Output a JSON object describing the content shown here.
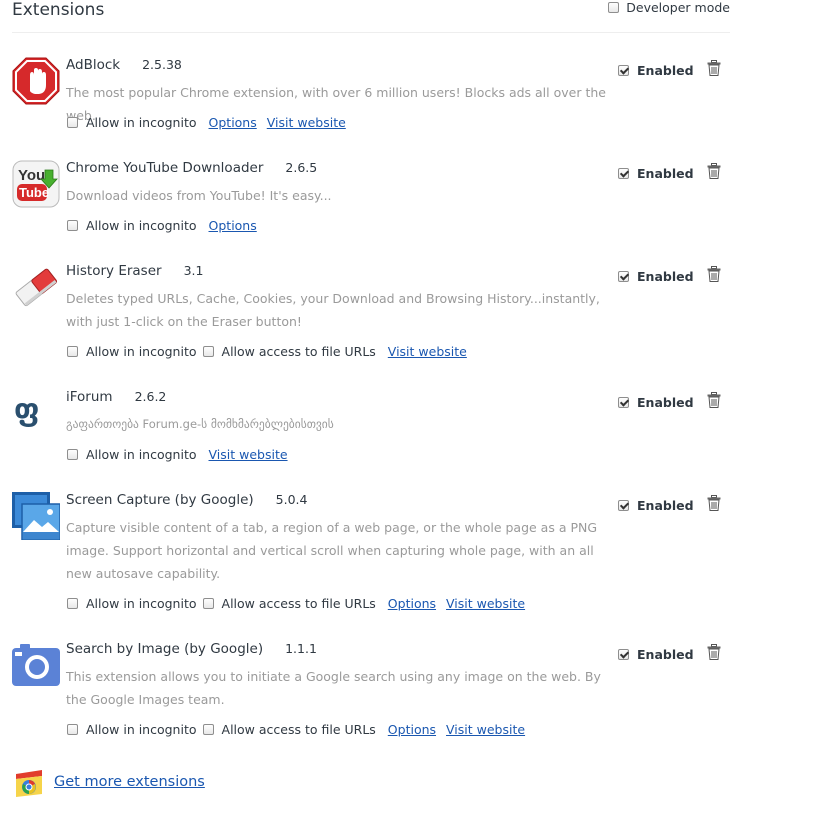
{
  "header": {
    "title": "Extensions",
    "developer_mode_label": "Developer mode",
    "developer_mode_checked": false
  },
  "common": {
    "enabled_label": "Enabled",
    "incognito_label": "Allow in incognito",
    "file_urls_label": "Allow access to file URLs",
    "options_label": "Options",
    "visit_label": "Visit website"
  },
  "extensions": [
    {
      "name": "AdBlock",
      "version": "2.5.38",
      "description": "The most popular Chrome extension, with over 6 million users! Blocks ads all over the web.",
      "enabled": true,
      "icon": "adblock-stop-hand-icon"
    },
    {
      "name": "Chrome YouTube Downloader",
      "version": "2.6.5",
      "description": "Download videos from YouTube! It's easy...",
      "enabled": true,
      "icon": "youtube-downloader-icon",
      "icon_text_top": "You",
      "icon_text_bottom": "Tube"
    },
    {
      "name": "History Eraser",
      "version": "3.1",
      "description": "Deletes typed URLs, Cache, Cookies, your Download and Browsing History...instantly, with just 1-click on the Eraser button!",
      "enabled": true,
      "icon": "eraser-icon"
    },
    {
      "name": "iForum",
      "version": "2.6.2",
      "description": "გაფართოება Forum.ge-ს მომხმარებლებისთვის",
      "enabled": true,
      "icon": "iforum-logo-icon",
      "icon_text": "ფ"
    },
    {
      "name": "Screen Capture (by Google)",
      "version": "5.0.4",
      "description": "Capture visible content of a tab, a region of a web page, or the whole page as a PNG image. Support horizontal and vertical scroll when capturing whole page, with an all new autosave capability.",
      "enabled": true,
      "icon": "screen-capture-icon"
    },
    {
      "name": "Search by Image (by Google)",
      "version": "1.1.1",
      "description": "This extension allows you to initiate a Google search using any image on the web. By the Google Images team.",
      "enabled": true,
      "icon": "camera-icon"
    }
  ],
  "footer": {
    "get_more_label": "Get more extensions",
    "icon": "chrome-web-store-icon"
  },
  "colors": {
    "link": "#1a57b0",
    "text": "#303942",
    "description": "#9a9a9a",
    "adblock_red": "#d6292b"
  }
}
